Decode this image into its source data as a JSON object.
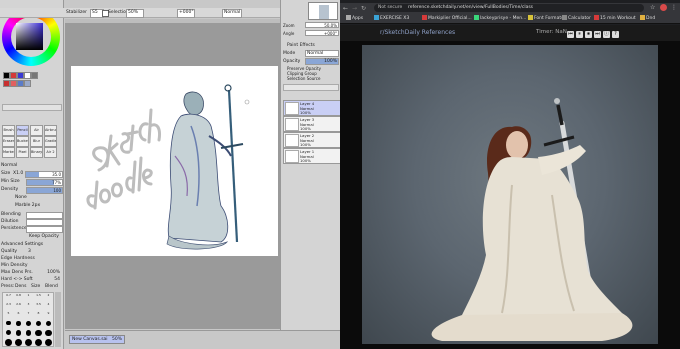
{
  "sai": {
    "toolbar": {
      "stabilizer_label": "Stabilizer",
      "stabilizer_value": "S5",
      "selection_label": "Selection",
      "zoom_value": "50%",
      "angle_value": "+000°",
      "blend_value": "Normal"
    },
    "navigator": {
      "zoom_label": "Zoom",
      "zoom_value": "50.0%",
      "angle_label": "Angle",
      "angle_value": "+000°"
    },
    "layer_panel": {
      "paint_effects_label": "Paint Effects",
      "mode_label": "Mode",
      "mode_value": "Normal",
      "opacity_label": "Opacity",
      "opacity_value": "100%",
      "preserve_opacity": "Preserve Opacity",
      "clipping_group": "Clipping Group",
      "selection_source": "Selection Source",
      "layers": [
        {
          "name": "Layer 4",
          "mode": "Normal",
          "opacity": "100%",
          "selected": true
        },
        {
          "name": "Layer 3",
          "mode": "Normal",
          "opacity": "100%",
          "selected": false
        },
        {
          "name": "Layer 2",
          "mode": "Normal",
          "opacity": "100%",
          "selected": false
        },
        {
          "name": "Layer 1",
          "mode": "Normal",
          "opacity": "100%",
          "selected": false
        }
      ]
    },
    "tools": [
      "Brush",
      "Pencil",
      "Air",
      "Airbrush",
      "Eraser",
      "Bucket",
      "Blur",
      "Gradient",
      "Marker",
      "Pixel",
      "Binary",
      "Air 2"
    ],
    "brush_props": {
      "mode": "Normal",
      "size_label": "Size",
      "size_mult": "X1.0",
      "size_value": "35.0",
      "min_size_label": "Min Size",
      "min_size_value": "77%",
      "density_label": "Density",
      "density_value": "100",
      "texture_label": "None",
      "texture2_label": "Marble 2px",
      "blending_label": "Blending",
      "dilution_label": "Dilution",
      "persistence_label": "Persistence",
      "keep_opacity": "Keep Opacity",
      "advanced_label": "Advanced Settings",
      "quality_label": "Quality",
      "quality_value": "3",
      "edge_hardness_label": "Edge Hardness",
      "min_density_label": "Min Density",
      "max_dens_label": "Max Dens Prs.",
      "max_dens_value": "100%",
      "hard_soft_label": "Hard <-> Soft",
      "hard_soft_value": "54",
      "press_label": "Press:",
      "press_dens": "Dens",
      "press_size": "Size",
      "press_blend": "Blend"
    },
    "brush_sizes": [
      "0.7",
      "0.8",
      "1",
      "1.5",
      "2",
      "2.3",
      "2.6",
      "3",
      "3.5",
      "4",
      "5",
      "6",
      "7",
      "8",
      "9",
      "10",
      "12",
      "14",
      "16",
      "20",
      "25",
      "30",
      "35",
      "40",
      "50",
      "60",
      "70",
      "80",
      "100",
      "120"
    ],
    "canvas_text": "Sketch doodle",
    "status_tab": "New Canvas.sai",
    "status_zoom": "50%"
  },
  "browser": {
    "tabs": [
      {
        "label": "EXERCISE X3"
      },
      {
        "label": "Markiplier Official..."
      },
      {
        "label": "lackeyprisye - Men..."
      },
      {
        "label": "Font Formats"
      },
      {
        "label": "Calculator"
      },
      {
        "label": "15 min Workout"
      },
      {
        "label": "Dnd"
      }
    ],
    "address": {
      "security": "Not secure",
      "url": "reference.sketchdaily.net/en/view/FullBodies/Time/class"
    },
    "apps_label": "Apps",
    "page_title": "r/SketchDaily References",
    "timer_label": "Timer: NaN",
    "controls": [
      "⏮",
      "⏸",
      "⏹",
      "⏭",
      "ⓘ",
      "?"
    ]
  },
  "colors": {
    "accent_selection": "#c9cff5",
    "browser_bg": "#0b0b0b"
  }
}
